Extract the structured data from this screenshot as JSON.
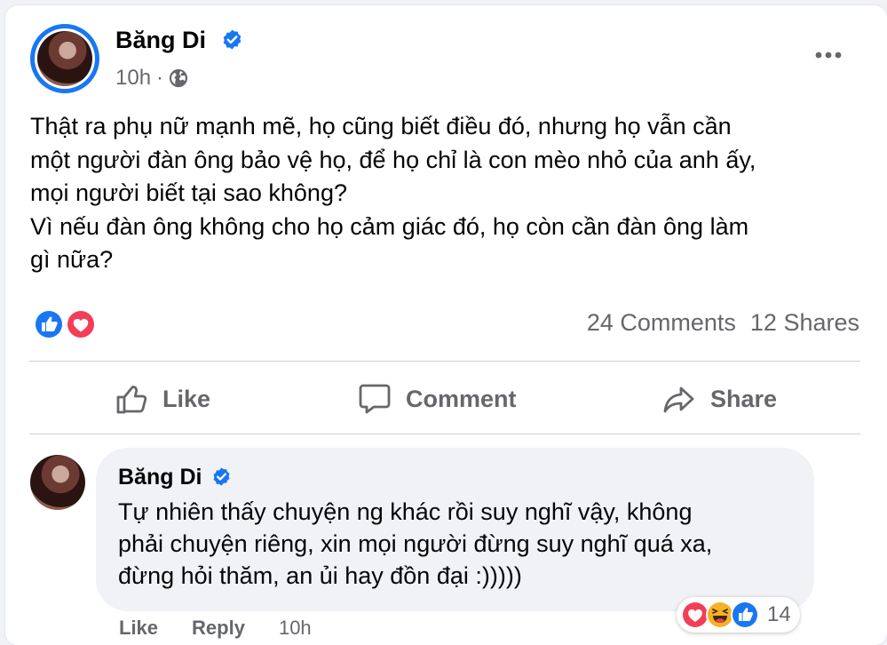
{
  "post": {
    "author": "Băng Di",
    "time": "10h",
    "separator": "·",
    "text": "Thật ra phụ nữ mạnh mẽ, họ cũng biết điều đó, nhưng họ vẫn cần\nmột người đàn ông bảo vệ họ, để họ chỉ là con mèo nhỏ của anh ấy,\nmọi người biết tại sao không?\nVì nếu đàn ông không cho họ cảm giác đó, họ còn cần đàn ông làm\ngì nữa?",
    "comments_count": "24 Comments",
    "shares_count": "12 Shares"
  },
  "actions": {
    "like": "Like",
    "comment": "Comment",
    "share": "Share"
  },
  "comment": {
    "author": "Băng Di",
    "text": "Tự nhiên thấy chuyện ng khác rồi suy nghĩ vậy, không\nphải chuyện riêng, xin mọi người đừng suy nghĩ quá xa,\nđừng hỏi thăm, an ủi hay đồn đại :)))))",
    "like_label": "Like",
    "reply_label": "Reply",
    "time": "10h",
    "reaction_count": "14"
  },
  "colors": {
    "brand_blue": "#1877f2",
    "love_red": "#f33e58",
    "haha_yellow": "#f7b125",
    "muted_text": "#65676b"
  },
  "icons": [
    "verified-badge-icon",
    "globe-icon",
    "more-options-icon",
    "like-reaction-icon",
    "love-reaction-icon",
    "haha-reaction-icon",
    "thumbs-up-icon",
    "comment-bubble-icon",
    "share-arrow-icon"
  ]
}
